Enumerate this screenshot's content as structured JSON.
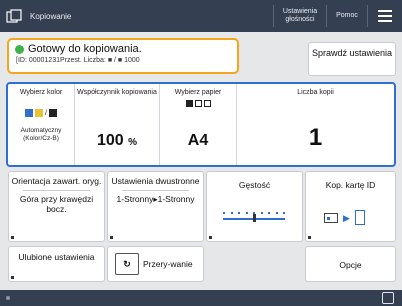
{
  "header": {
    "title": "Kopiowanie",
    "settings_label": "Ustawienia głośności",
    "help_label": "Pomoc"
  },
  "status": {
    "message": "Gotowy do kopiowania.",
    "detail": "[ID: 00001231Przest. Liczba: ■ / ■ 1000",
    "check_button": "Sprawdź ustawienia"
  },
  "panel": {
    "color": {
      "label": "Wybierz kolor",
      "value": "Automatyczny (Kolor/Cz-B)"
    },
    "ratio": {
      "label": "Współczynnik kopiowania",
      "value": "100",
      "unit": "%"
    },
    "paper": {
      "label": "Wybierz papier",
      "value": "A4"
    },
    "copies": {
      "label": "Liczba kopii",
      "value": "1"
    }
  },
  "functions": {
    "orientation": {
      "label": "Orientacja zawart. oryg.",
      "value": "Góra przy krawędzi bocz."
    },
    "duplex": {
      "label": "Ustawienia dwustronne",
      "value": "1-Stronny▸1-Stronny"
    },
    "density": {
      "label": "Gęstość",
      "level": 0.5
    },
    "id_card": {
      "label": "Kop. kartę ID"
    }
  },
  "bottom": {
    "favorites": "Ulubione ustawienia",
    "interrupt": "Przery-wanie",
    "options": "Opcje"
  },
  "colors": {
    "accent": "#2f6fd0",
    "status_border": "#f3a51d",
    "ready": "#3cb44b",
    "bar": "#343f52"
  }
}
